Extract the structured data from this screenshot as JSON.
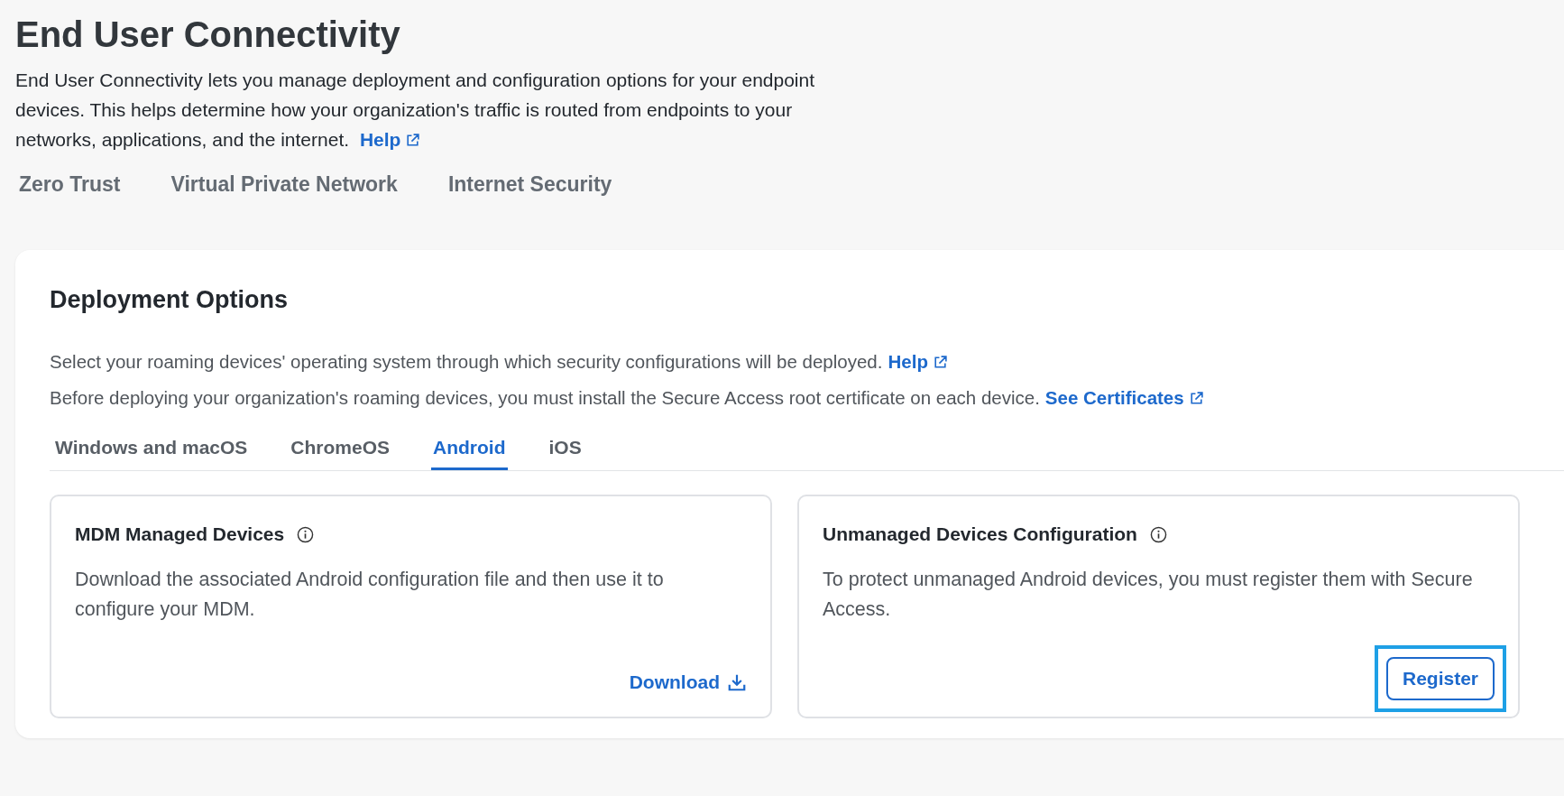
{
  "page": {
    "title": "End User Connectivity",
    "description": "End User Connectivity lets you manage deployment and configuration options for your endpoint devices. This helps determine how your organization's traffic is routed from endpoints to your networks, applications, and the internet.",
    "help_link": "Help"
  },
  "top_tabs": [
    {
      "label": "Zero Trust",
      "selected": false
    },
    {
      "label": "Virtual Private Network",
      "selected": false
    },
    {
      "label": "Internet Security",
      "selected": false
    }
  ],
  "deployment": {
    "title": "Deployment Options",
    "notes": [
      {
        "text": "Select your roaming devices' operating system through which security configurations will be deployed.",
        "link": "Help"
      },
      {
        "text": "Before deploying your organization's roaming devices, you must install the Secure Access root certificate on each device.",
        "link": "See Certificates"
      }
    ],
    "os_tabs": [
      {
        "label": "Windows and macOS",
        "selected": false
      },
      {
        "label": "ChromeOS",
        "selected": false
      },
      {
        "label": "Android",
        "selected": true
      },
      {
        "label": "iOS",
        "selected": false
      }
    ],
    "cards": [
      {
        "title": "MDM Managed Devices",
        "description": "Download the associated Android configuration file and then use it to configure your MDM.",
        "action": {
          "kind": "link",
          "label": "Download",
          "highlighted": false
        }
      },
      {
        "title": "Unmanaged Devices Configuration",
        "description": "To protect unmanaged Android devices, you must register them with Secure Access.",
        "action": {
          "kind": "button",
          "label": "Register",
          "highlighted": true
        }
      }
    ]
  }
}
